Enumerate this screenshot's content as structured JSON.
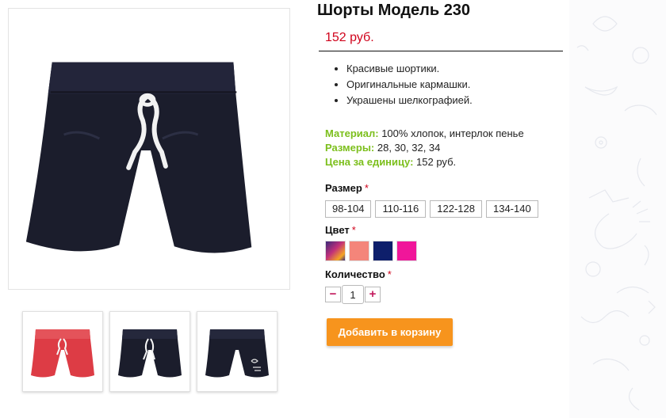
{
  "product": {
    "title": "Шорты Модель 230",
    "price": "152 руб.",
    "features": [
      "Красивые шортики.",
      "Оригинальные кармашки.",
      "Украшены шелкографией."
    ],
    "specs": {
      "material_label": "Материал:",
      "material_value": "100% хлопок, интерлок пенье",
      "sizes_label": "Размеры:",
      "sizes_value": "28, 30, 32, 34",
      "unit_price_label": "Цена за единицу:",
      "unit_price_value": "152 руб."
    }
  },
  "options": {
    "size_label": "Размер",
    "required_mark": "*",
    "sizes": [
      "98-104",
      "110-116",
      "122-128",
      "134-140"
    ],
    "color_label": "Цвет",
    "colors": [
      {
        "name": "multicolor",
        "value": "linear-gradient(135deg,#3b2a7a 0%,#c2307a 45%,#f5a623 80%,#3b2a7a 100%)"
      },
      {
        "name": "salmon",
        "value": "#f4857a"
      },
      {
        "name": "navy",
        "value": "#0e1f6b"
      },
      {
        "name": "magenta",
        "value": "#f0169a"
      }
    ],
    "qty_label": "Количество",
    "qty_value": "1",
    "minus": "−",
    "plus": "+"
  },
  "cart": {
    "button_label": "Добавить в корзину"
  },
  "gallery": {
    "main_color": "#1b1d2c",
    "thumbs": [
      {
        "name": "red-shorts",
        "color": "#dd3c45"
      },
      {
        "name": "navy-shorts",
        "color": "#1b1d2c"
      },
      {
        "name": "navy-shorts-print",
        "color": "#1b1d2c"
      }
    ]
  },
  "colors": {
    "accent_orange": "#f7941d",
    "price_red": "#d0021b",
    "label_green": "#7cbf1c"
  }
}
